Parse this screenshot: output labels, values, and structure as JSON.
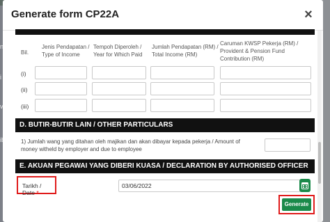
{
  "backdrop": {
    "left_fragments": [
      "n",
      "i",
      "vi",
      "ib"
    ]
  },
  "modal": {
    "title": "Generate form CP22A",
    "close_icon": "close-icon"
  },
  "table": {
    "headers": {
      "bil": "Bil.",
      "income_type": "Jenis Pendapatan / Type of Income",
      "year_paid": "Tempoh Diperoleh / Year for Which Paid",
      "total_income": "Jumlah Pendapatan (RM) / Total Income (RM)",
      "kwsp": "Caruman KWSP Pekerja (RM) / Provident & Pension Fund Contribution (RM)"
    },
    "rows": [
      {
        "label": "(i)"
      },
      {
        "label": "(ii)"
      },
      {
        "label": "(iii)"
      }
    ]
  },
  "section_d": {
    "title": "D. BUTIR-BUTIR LAIN / OTHER PARTICULARS",
    "item1": "1) Jumlah wang yang ditahan oleh majikan dan akan dibayar kepada pekerja / Amount of money witheld by employer and due to employee"
  },
  "section_e": {
    "title": "E. AKUAN PEGAWAI YANG DIBERI KUASA / DECLARATION BY AUTHORISED OFFICER",
    "date_label": "Tarikh / Date",
    "required_mark": "*",
    "date_value": "03/06/2022",
    "calendar_icon": "calendar-icon"
  },
  "actions": {
    "generate_label": "Generate"
  },
  "colors": {
    "primary": "#1a8a4a",
    "highlight": "#e01a1a",
    "section_bar": "#111111"
  }
}
